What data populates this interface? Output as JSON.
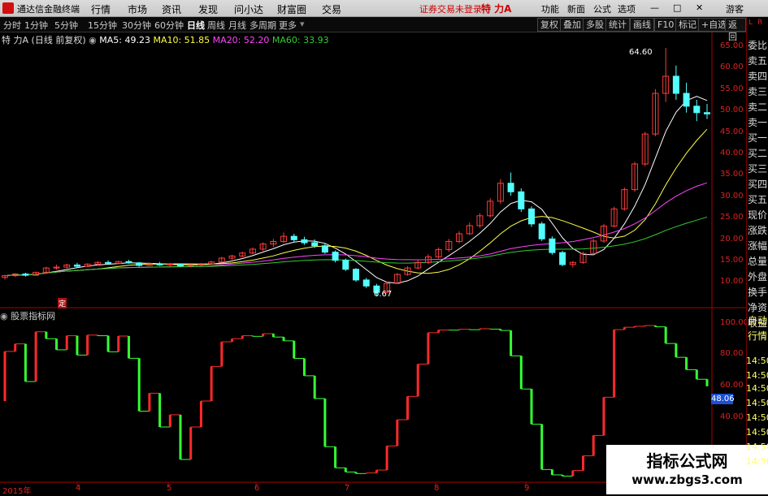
{
  "titlebar": {
    "app_name": "通达信金融终端",
    "menus": [
      "行情",
      "市场",
      "资讯",
      "发现",
      "问小达",
      "财富圈",
      "交易"
    ],
    "notice": "证券交易未登录",
    "stock": "特 力A",
    "right_menus": [
      "功能",
      "新面",
      "公式",
      "选项"
    ],
    "guest": "游客"
  },
  "toolbar": {
    "periods": [
      "分时",
      "1分钟",
      "5分钟",
      "15分钟",
      "30分钟",
      "60分钟",
      "日线",
      "周线",
      "月线",
      "多周期",
      "更多"
    ],
    "active": "日线",
    "right_buttons": [
      "复权",
      "叠加",
      "多股",
      "统计",
      "画线",
      "F10",
      "标记",
      "+自选",
      "返回"
    ]
  },
  "info": {
    "name": "特 力A",
    "mode": "(日线 前复权)",
    "ma5": "MA5: 49.23",
    "ma10": "MA10: 51.85",
    "ma20": "MA20: 52.20",
    "ma60": "MA60: 33.93",
    "colors": {
      "ma5": "#ffffff",
      "ma10": "#ffff44",
      "ma20": "#ff44ff",
      "ma60": "#33cc33"
    }
  },
  "right_panel": [
    "委比",
    "卖五",
    "卖四",
    "卖三",
    "卖二",
    "卖一",
    "买一",
    "买二",
    "买三",
    "买四",
    "买五",
    "现价",
    "涨跌",
    "涨幅",
    "总量",
    "外盘",
    "换手",
    "净资",
    "收益",
    "自动",
    "行情"
  ],
  "price_axis": [
    "65.00",
    "60.00",
    "55.00",
    "50.00",
    "45.00",
    "40.00",
    "35.00",
    "30.00",
    "25.00",
    "20.00",
    "15.00",
    "10.00"
  ],
  "annotations": {
    "high": "64.60",
    "low": "6.67",
    "marker": "定"
  },
  "indicator": {
    "name": "股票指标网",
    "axis": [
      "100.00",
      "80.00",
      "60.00",
      "40.00"
    ],
    "current_value": "48.06",
    "time_labels": [
      "14:50",
      "14:50",
      "14:50",
      "14:50",
      "14:50",
      "14:50",
      "14:50",
      "14:50"
    ]
  },
  "x_axis": [
    "2015年",
    "4",
    "5",
    "6",
    "7",
    "8",
    "9"
  ],
  "watermark": {
    "title": "指标公式网",
    "url": "www.zbgs3.com"
  },
  "chart_data": {
    "type": "candlestick",
    "price_range": [
      5,
      67
    ],
    "candles": [
      [
        11.0,
        11.6,
        10.5,
        11.4
      ],
      [
        11.4,
        12.0,
        11.1,
        11.8
      ],
      [
        11.8,
        12.1,
        11.2,
        11.5
      ],
      [
        11.5,
        12.3,
        11.4,
        12.2
      ],
      [
        12.2,
        13.5,
        12.0,
        13.2
      ],
      [
        13.2,
        14.0,
        12.8,
        13.4
      ],
      [
        13.4,
        14.2,
        13.1,
        13.9
      ],
      [
        13.9,
        14.4,
        13.3,
        13.6
      ],
      [
        13.6,
        14.3,
        13.4,
        14.1
      ],
      [
        14.1,
        14.8,
        13.8,
        14.5
      ],
      [
        14.5,
        15.0,
        14.0,
        14.3
      ],
      [
        14.3,
        14.9,
        14.1,
        14.7
      ],
      [
        14.7,
        15.1,
        14.2,
        14.4
      ],
      [
        14.4,
        14.6,
        13.5,
        13.8
      ],
      [
        13.8,
        14.5,
        13.6,
        14.2
      ],
      [
        14.2,
        14.6,
        13.7,
        13.9
      ],
      [
        13.9,
        14.4,
        13.5,
        14.1
      ],
      [
        14.1,
        14.3,
        13.5,
        13.7
      ],
      [
        13.7,
        14.1,
        13.3,
        13.9
      ],
      [
        13.9,
        14.4,
        13.6,
        14.2
      ],
      [
        14.2,
        14.9,
        14.0,
        14.6
      ],
      [
        14.6,
        15.8,
        14.4,
        15.5
      ],
      [
        15.5,
        16.3,
        15.1,
        16.0
      ],
      [
        16.0,
        17.0,
        15.7,
        16.7
      ],
      [
        16.7,
        18.0,
        16.4,
        17.6
      ],
      [
        17.6,
        19.2,
        17.2,
        18.8
      ],
      [
        18.8,
        20.0,
        18.1,
        19.4
      ],
      [
        19.4,
        21.5,
        19.0,
        20.6
      ],
      [
        20.6,
        21.2,
        19.3,
        19.8
      ],
      [
        19.8,
        20.5,
        18.6,
        19.1
      ],
      [
        19.1,
        19.9,
        17.9,
        18.4
      ],
      [
        18.4,
        19.0,
        16.5,
        16.9
      ],
      [
        16.9,
        17.3,
        14.5,
        15.0
      ],
      [
        15.0,
        15.4,
        12.5,
        12.9
      ],
      [
        12.9,
        13.2,
        10.0,
        10.4
      ],
      [
        10.4,
        10.9,
        8.5,
        9.0
      ],
      [
        9.0,
        9.5,
        6.67,
        7.5
      ],
      [
        7.5,
        10.0,
        7.3,
        9.6
      ],
      [
        9.6,
        12.0,
        9.4,
        11.7
      ],
      [
        11.7,
        13.6,
        11.4,
        13.2
      ],
      [
        13.2,
        15.0,
        12.9,
        14.5
      ],
      [
        14.5,
        16.4,
        14.1,
        15.8
      ],
      [
        15.8,
        18.0,
        15.4,
        17.5
      ],
      [
        17.5,
        20.0,
        17.0,
        19.4
      ],
      [
        19.4,
        21.8,
        19.0,
        21.2
      ],
      [
        21.2,
        23.8,
        20.9,
        23.1
      ],
      [
        23.1,
        26.0,
        22.6,
        25.4
      ],
      [
        25.4,
        29.5,
        25.0,
        28.8
      ],
      [
        28.8,
        34.0,
        28.2,
        33.0
      ],
      [
        33.0,
        35.5,
        30.1,
        31.0
      ],
      [
        31.0,
        31.8,
        26.3,
        27.0
      ],
      [
        27.0,
        27.6,
        22.8,
        23.5
      ],
      [
        23.5,
        24.0,
        19.5,
        20.0
      ],
      [
        20.0,
        20.6,
        16.3,
        16.8
      ],
      [
        16.8,
        17.2,
        13.6,
        14.0
      ],
      [
        14.0,
        14.8,
        13.3,
        14.5
      ],
      [
        14.5,
        17.0,
        14.2,
        16.6
      ],
      [
        16.6,
        20.0,
        16.3,
        19.5
      ],
      [
        19.5,
        23.5,
        19.1,
        23.0
      ],
      [
        23.0,
        27.5,
        22.7,
        27.0
      ],
      [
        27.0,
        32.0,
        26.6,
        31.5
      ],
      [
        31.5,
        38.0,
        31.0,
        37.5
      ],
      [
        37.5,
        45.0,
        37.0,
        44.5
      ],
      [
        44.5,
        55.0,
        44.0,
        54.0
      ],
      [
        54.0,
        64.6,
        52.0,
        58.0
      ],
      [
        58.0,
        60.5,
        52.5,
        54.0
      ],
      [
        54.0,
        56.5,
        49.5,
        51.0
      ],
      [
        51.0,
        52.5,
        47.5,
        49.5
      ],
      [
        49.5,
        51.5,
        48.0,
        49.2
      ]
    ]
  }
}
